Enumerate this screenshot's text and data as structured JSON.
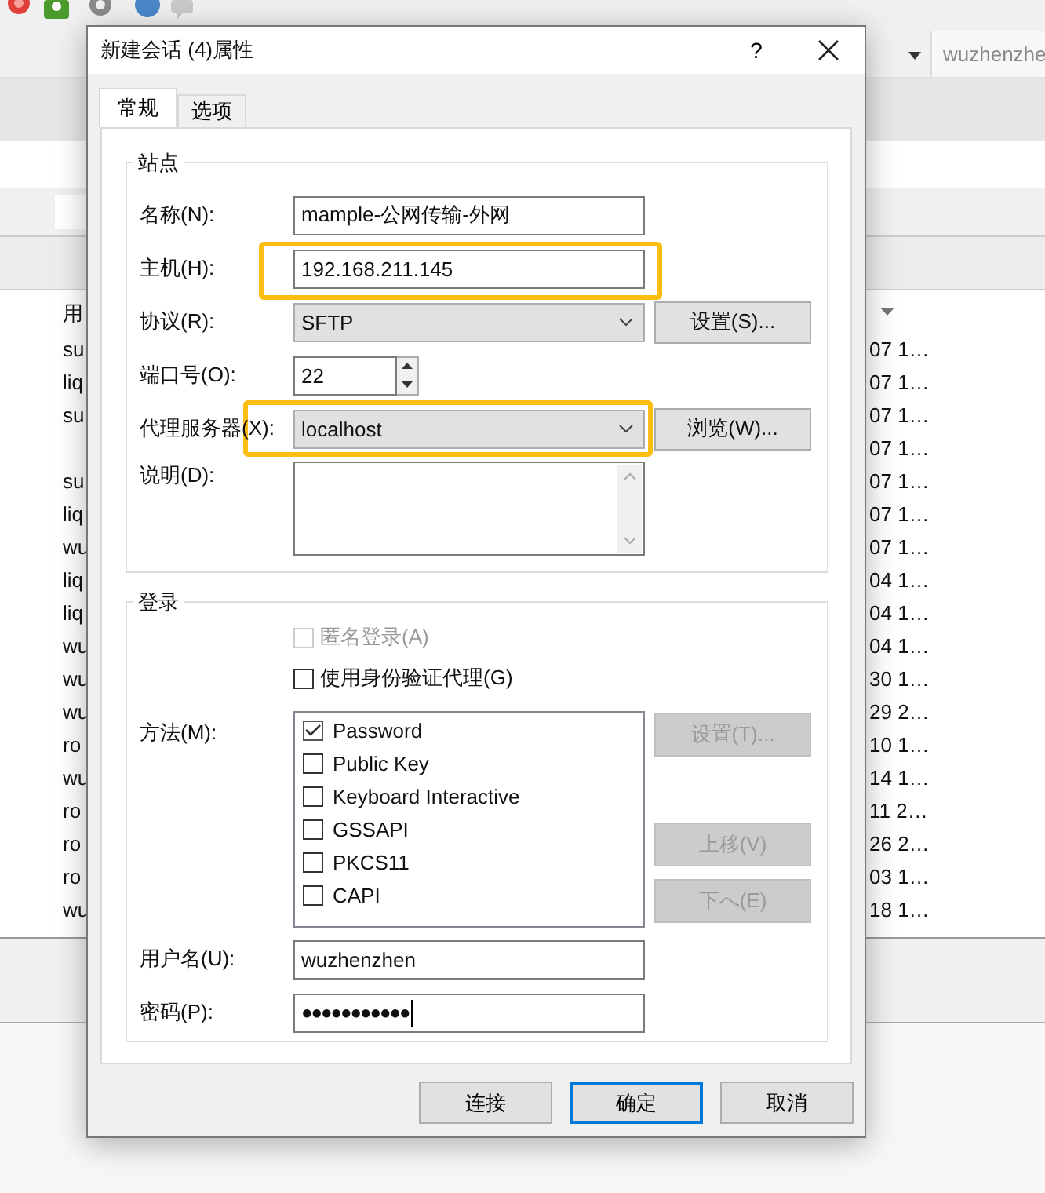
{
  "background_app": {
    "account_field": "wuzhenzhe",
    "list": {
      "column_1": "用",
      "rows": [
        {
          "column_1": "su",
          "column_2": "07 1…"
        },
        {
          "column_1": "liq",
          "column_2": "07 1…"
        },
        {
          "column_1": "su",
          "column_2": "07 1…"
        },
        {
          "column_2": "07 1…"
        },
        {
          "column_1": "su",
          "column_2": "07 1…"
        },
        {
          "column_1": "liq",
          "column_2": "07 1…"
        },
        {
          "column_1": "wu",
          "column_2": "07 1…"
        },
        {
          "column_1": "liq",
          "column_2": "04 1…"
        },
        {
          "column_1": "liq",
          "column_2": "04 1…"
        },
        {
          "column_1": "wu",
          "column_2": "04 1…"
        },
        {
          "column_1": "wu",
          "column_2": "30 1…"
        },
        {
          "column_1": "wu",
          "column_2": "29 2…"
        },
        {
          "column_1": "ro",
          "column_2": "10 1…"
        },
        {
          "column_1": "wu",
          "column_2": "14 1…"
        },
        {
          "column_1": "ro",
          "column_2": "11 2…"
        },
        {
          "column_1": "ro",
          "column_2": "26 2…"
        },
        {
          "column_1": "ro",
          "column_2": "03 1…"
        },
        {
          "column_1": "wu",
          "column_2": "18 1…"
        }
      ]
    }
  },
  "dialog": {
    "title": "新建会话 (4)属性",
    "help": "?",
    "tabs": [
      {
        "label": "常规",
        "selected": true
      },
      {
        "label": "选项",
        "selected": false
      }
    ],
    "site_group": {
      "title": "站点",
      "fields": [
        {
          "kind": "text",
          "label": "名称(N):",
          "value": "mample-公网传输-外网",
          "highlighted": false
        },
        {
          "kind": "text",
          "label": "主机(H):",
          "value": "192.168.211.145",
          "highlighted": true
        },
        {
          "kind": "select",
          "label": "协议(R):",
          "value": "SFTP",
          "highlighted": false,
          "button": {
            "label": "设置(S)...",
            "disabled": false
          }
        },
        {
          "kind": "spinner",
          "label": "端口号(O):",
          "value": "22",
          "highlighted": false
        },
        {
          "kind": "select",
          "label": "代理服务器(X):",
          "value": "localhost",
          "highlighted": true,
          "button": {
            "label": "浏览(W)...",
            "disabled": false
          }
        },
        {
          "kind": "textarea",
          "label": "说明(D):",
          "highlighted": false
        }
      ]
    },
    "login_group": {
      "title": "登录",
      "checkboxes": [
        {
          "label": "匿名登录(A)",
          "checked": false,
          "disabled": true
        },
        {
          "label": "使用身份验证代理(G)",
          "checked": false,
          "disabled": false
        }
      ],
      "method_label": "方法(M):",
      "methods": [
        {
          "label": "Password",
          "checked": true
        },
        {
          "label": "Public Key",
          "checked": false
        },
        {
          "label": "Keyboard Interactive",
          "checked": false
        },
        {
          "label": "GSSAPI",
          "checked": false
        },
        {
          "label": "PKCS11",
          "checked": false
        },
        {
          "label": "CAPI",
          "checked": false
        }
      ],
      "method_buttons": [
        {
          "label": "设置(T)...",
          "disabled": true
        },
        {
          "label": "上移(V)",
          "disabled": true
        },
        {
          "label": "下へ(E)",
          "disabled": true
        }
      ],
      "username": {
        "label": "用户名(U):",
        "value": "wuzhenzhen"
      },
      "password": {
        "label": "密码(P):",
        "value": "●●●●●●●●●●●"
      }
    },
    "buttons": [
      {
        "label": "连接",
        "default": false
      },
      {
        "label": "确定",
        "default": true
      },
      {
        "label": "取消",
        "default": false
      }
    ]
  }
}
